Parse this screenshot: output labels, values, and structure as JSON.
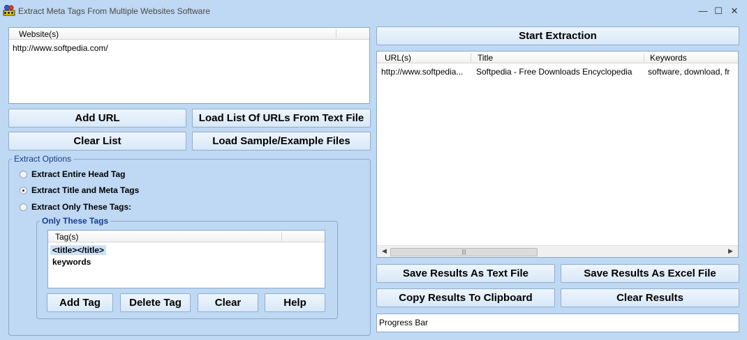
{
  "window": {
    "title": "Extract Meta Tags From Multiple Websites Software",
    "min_icon": "minimize-icon",
    "max_icon": "maximize-icon",
    "close_icon": "close-icon",
    "min_glyph": "—",
    "max_glyph": "☐",
    "close_glyph": "✕"
  },
  "websites": {
    "header": "Website(s)",
    "items": [
      "http://www.softpedia.com/"
    ]
  },
  "left_buttons": {
    "add_url": "Add URL",
    "load_list": "Load List Of URLs From Text File",
    "clear_list": "Clear List",
    "load_sample": "Load Sample/Example Files"
  },
  "extract_options": {
    "label": "Extract Options",
    "options": [
      {
        "label": "Extract Entire Head Tag",
        "checked": false
      },
      {
        "label": "Extract Title and Meta Tags",
        "checked": true
      },
      {
        "label": "Extract Only These Tags:",
        "checked": false
      }
    ]
  },
  "only_these_tags": {
    "label": "Only These Tags",
    "header": "Tag(s)",
    "items": [
      "<title></title>",
      "keywords"
    ],
    "selected_index": 0
  },
  "tag_buttons": {
    "add_tag": "Add Tag",
    "delete_tag": "Delete Tag",
    "clear": "Clear",
    "help": "Help"
  },
  "results": {
    "start_label": "Start Extraction",
    "columns": [
      "URL(s)",
      "Title",
      "Keywords"
    ],
    "rows": [
      [
        "http://www.softpedia...",
        "Softpedia - Free Downloads Encyclopedia",
        "software, download, fr"
      ]
    ],
    "scroll_thumb_glyph": "|||",
    "scroll_left_glyph": "◀",
    "scroll_right_glyph": "▶"
  },
  "right_buttons": {
    "save_text": "Save Results As Text File",
    "save_excel": "Save Results As Excel File",
    "copy_clipboard": "Copy Results To Clipboard",
    "clear_results": "Clear Results"
  },
  "progress": {
    "label": "Progress Bar"
  },
  "colors": {
    "background": "#bfd8f3",
    "group_label": "#1a3d8f",
    "selection": "#cce0f7"
  }
}
